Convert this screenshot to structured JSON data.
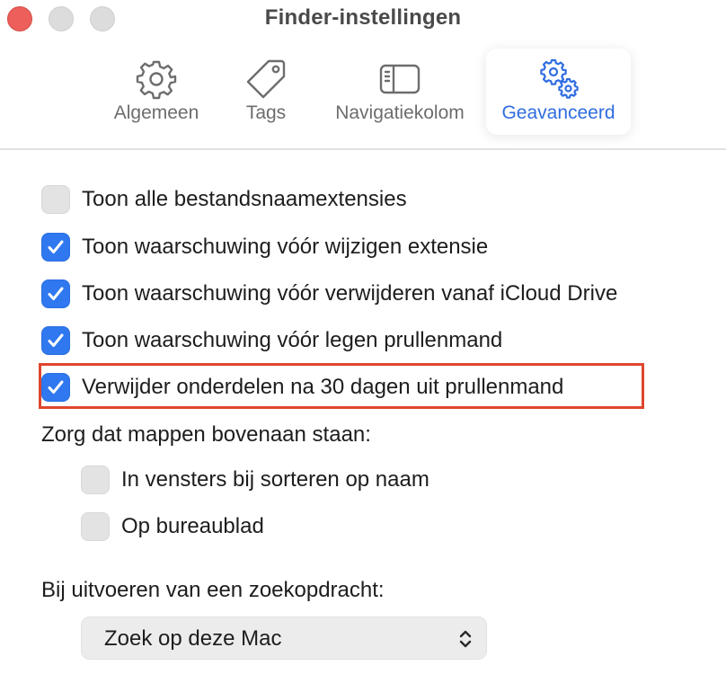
{
  "window": {
    "title": "Finder-instellingen"
  },
  "toolbar": {
    "tabs": [
      {
        "label": "Algemeen",
        "icon": "gear-icon",
        "active": false
      },
      {
        "label": "Tags",
        "icon": "tag-icon",
        "active": false
      },
      {
        "label": "Navigatiekolom",
        "icon": "sidebar-icon",
        "active": false
      },
      {
        "label": "Geavanceerd",
        "icon": "gears-icon",
        "active": true
      }
    ]
  },
  "settings": {
    "checkboxes": [
      {
        "label": "Toon alle bestandsnaamextensies",
        "checked": false
      },
      {
        "label": "Toon waarschuwing vóór wijzigen extensie",
        "checked": true
      },
      {
        "label": "Toon waarschuwing vóór verwijderen vanaf iCloud Drive",
        "checked": true
      },
      {
        "label": "Toon waarschuwing vóór legen prullenmand",
        "checked": true
      },
      {
        "label": "Verwijder onderdelen na 30 dagen uit prullenmand",
        "checked": true
      }
    ],
    "folders_heading": "Zorg dat mappen bovenaan staan:",
    "folder_options": [
      {
        "label": "In vensters bij sorteren op naam",
        "checked": false
      },
      {
        "label": "Op bureaublad",
        "checked": false
      }
    ],
    "search_heading": "Bij uitvoeren van een zoekopdracht:",
    "search_scope": {
      "selected": "Zoek op deze Mac"
    }
  },
  "colors": {
    "accent": "#2f78ef",
    "active_tab_text": "#2f6de1",
    "highlight_border": "#e0462f",
    "close_button": "#ec5f5a"
  }
}
